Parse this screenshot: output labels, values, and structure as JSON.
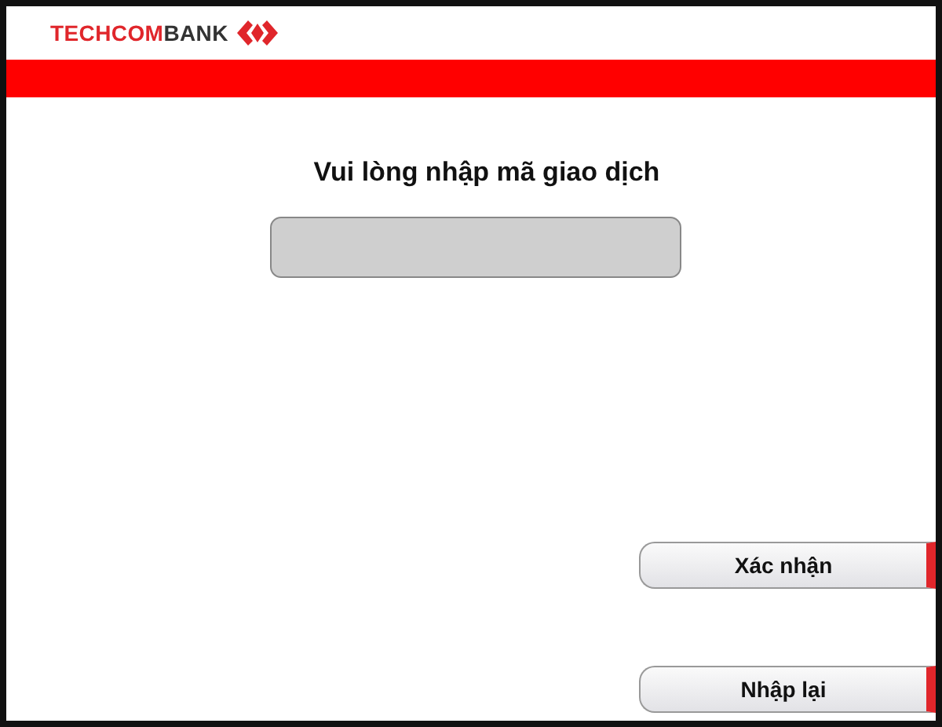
{
  "logo": {
    "parts": [
      {
        "text": "TECHCOM",
        "color": "#e0262b"
      },
      {
        "text": "BANK",
        "color": "#333333"
      }
    ]
  },
  "prompt": "Vui lòng nhập mã giao dịch",
  "buttons": [
    {
      "label": "Xác nhận"
    },
    {
      "label": "Nhập lại"
    }
  ]
}
